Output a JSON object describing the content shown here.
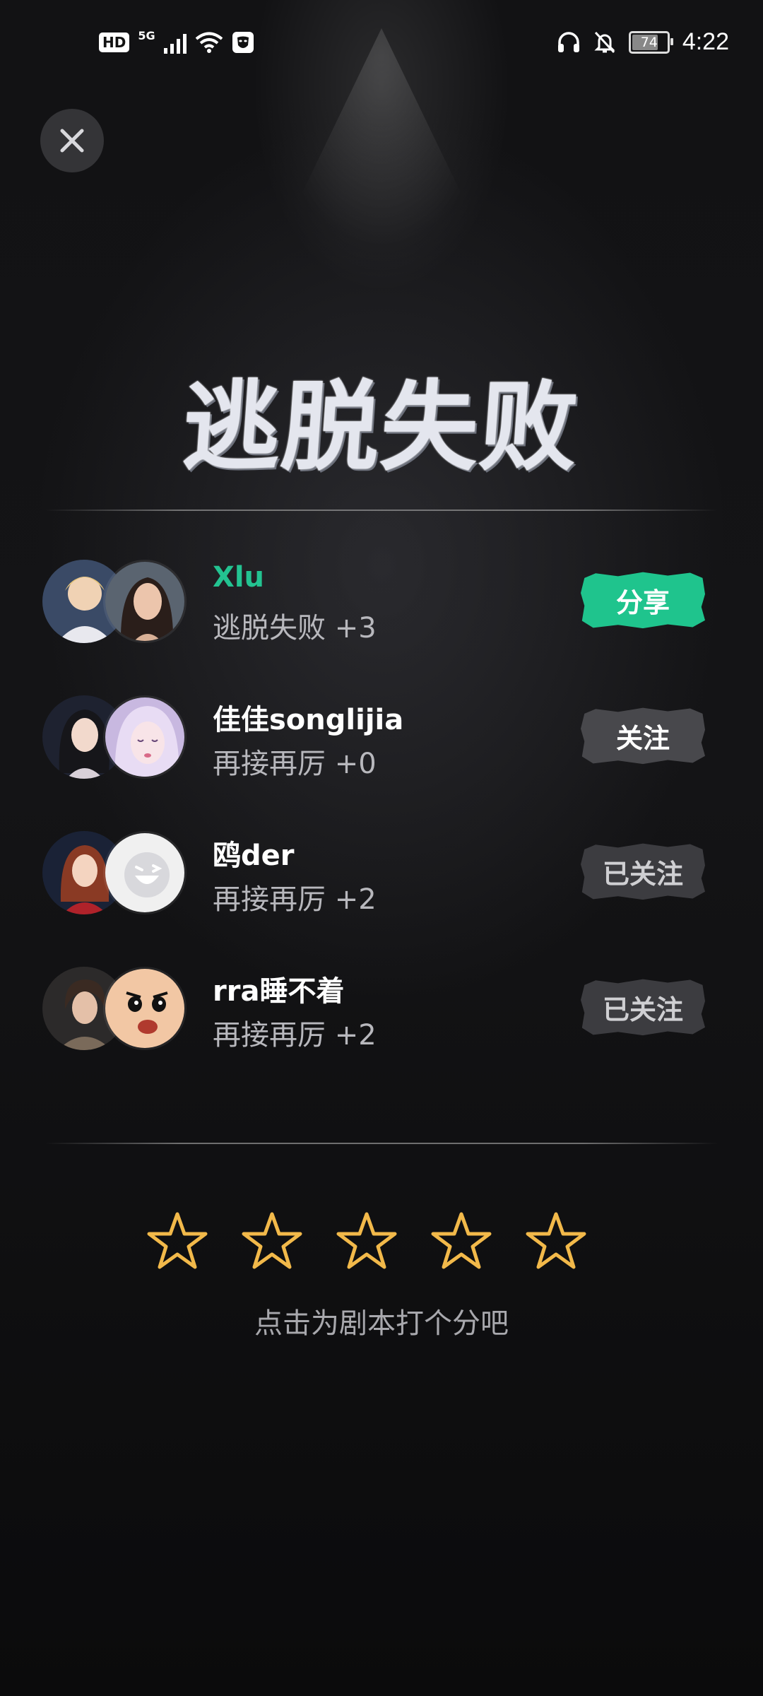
{
  "status_bar": {
    "hd": "HD",
    "network": "5G",
    "battery": "74",
    "time": "4:22"
  },
  "title": "逃脱失败",
  "players": [
    {
      "name": "Xlu",
      "result": "逃脱失败 +3",
      "button": "分享"
    },
    {
      "name": "佳佳songlijia",
      "result": "再接再厉 +0",
      "button": "关注"
    },
    {
      "name": "鸥der",
      "result": "再接再厉 +2",
      "button": "已关注"
    },
    {
      "name": "rra睡不着",
      "result": "再接再厉 +2",
      "button": "已关注"
    }
  ],
  "rating": {
    "stars_selected": 0,
    "star_count": 5,
    "hint": "点击为剧本打个分吧"
  },
  "colors": {
    "accent_green": "#1fc48d",
    "star_outline": "#f2b94a"
  }
}
